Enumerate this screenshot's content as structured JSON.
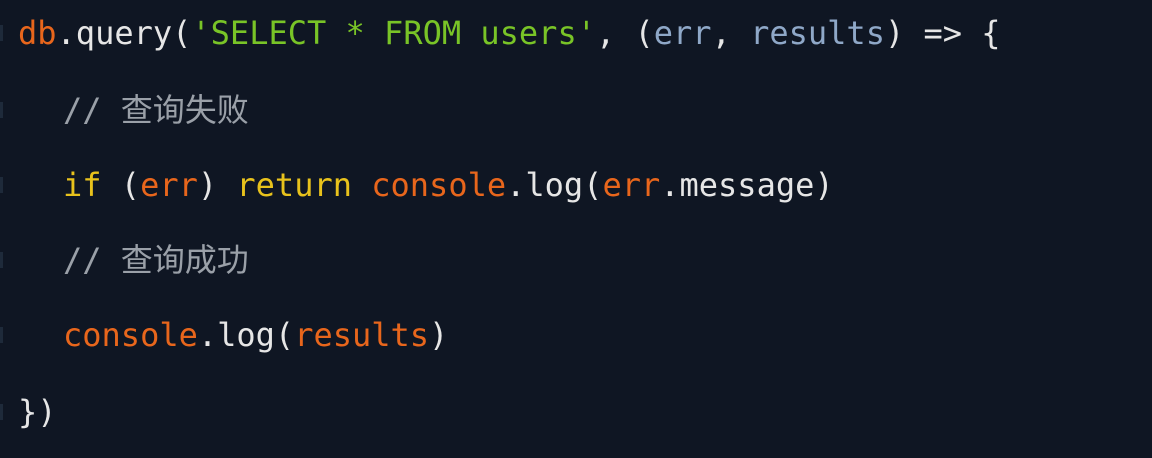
{
  "code": {
    "line1": {
      "obj": "db",
      "dot": ".",
      "method": "query",
      "open": "(",
      "sql": "'SELECT * FROM users'",
      "comma": ", ",
      "paren_open": "(",
      "param1": "err",
      "sep": ", ",
      "param2": "results",
      "arrow": ") => {"
    },
    "line2": {
      "comment": "// 查询失败"
    },
    "line3": {
      "if_kw": "if",
      "open": " (",
      "err": "err",
      "close": ") ",
      "return_kw": "return",
      "space": " ",
      "console": "console",
      "log": ".log(",
      "err2": "err",
      "message": ".message)"
    },
    "line4": {
      "comment": "// 查询成功"
    },
    "line5": {
      "console": "console",
      "log": ".log(",
      "results": "results",
      "close": ")"
    },
    "line6": {
      "close": "})"
    }
  },
  "colors": {
    "background": "#0f1623",
    "variable": "#e8661c",
    "string": "#79c427",
    "parameter": "#8fa8c8",
    "keyword": "#e8c21c",
    "comment": "#9aa0a8",
    "plain": "#e6e6e6"
  }
}
